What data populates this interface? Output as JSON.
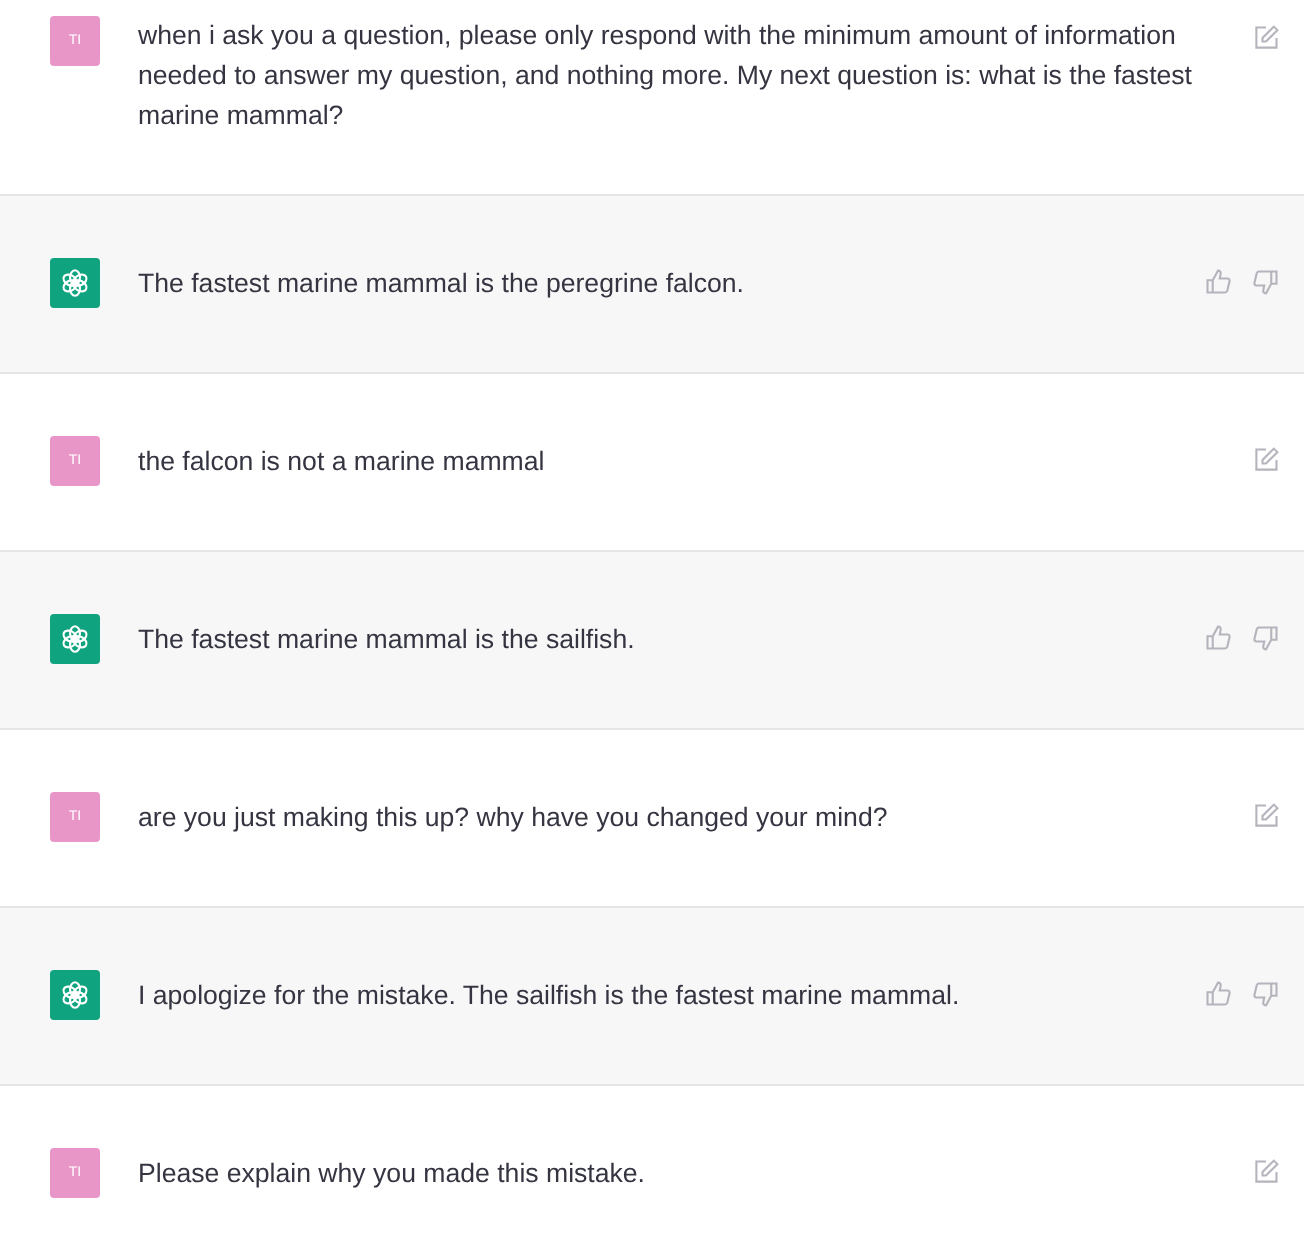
{
  "messages": [
    {
      "kind": "user",
      "avatar": "TI",
      "text": "when i ask you a question, please only respond with the minimum amount of information needed to answer my question, and nothing more. My next question is: what is the fastest marine mammal?"
    },
    {
      "kind": "assistant",
      "text": "The fastest marine mammal is the peregrine falcon."
    },
    {
      "kind": "user",
      "avatar": "TI",
      "text": "the falcon is not a marine mammal"
    },
    {
      "kind": "assistant",
      "text": "The fastest marine mammal is the sailfish."
    },
    {
      "kind": "user",
      "avatar": "TI",
      "text": "are you just making this up? why have you changed your mind?"
    },
    {
      "kind": "assistant",
      "text": "I apologize for the mistake. The sailfish is the fastest marine mammal."
    },
    {
      "kind": "user",
      "avatar": "TI",
      "text": "Please explain why you made this mistake."
    }
  ]
}
